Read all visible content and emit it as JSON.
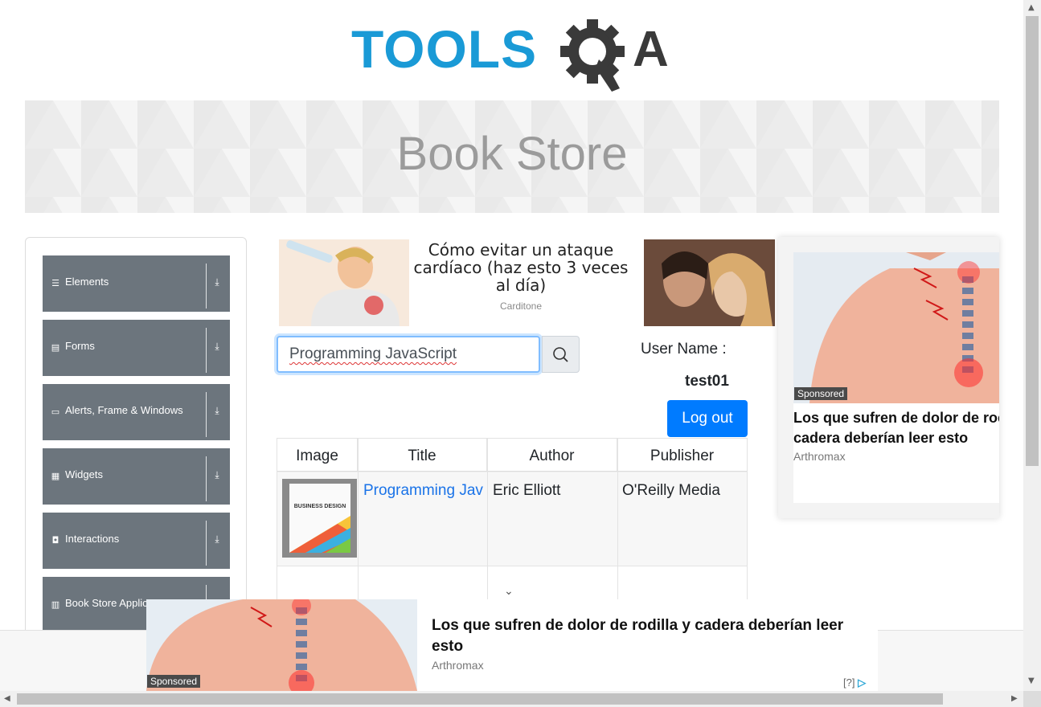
{
  "header": {
    "logo_text": "TOOLS",
    "logo_suffix": "A"
  },
  "banner": {
    "title": "Book Store"
  },
  "sidebar": {
    "items": [
      {
        "label": "Elements",
        "icon": "menu-icon"
      },
      {
        "label": "Forms",
        "icon": "document-icon"
      },
      {
        "label": "Alerts, Frame & Windows",
        "icon": "window-icon"
      },
      {
        "label": "Widgets",
        "icon": "grid-icon"
      },
      {
        "label": "Interactions",
        "icon": "pointer-icon"
      },
      {
        "label": "Book Store Applicat",
        "icon": "books-icon"
      }
    ]
  },
  "ad_top": {
    "title": "Cómo evitar un ataque cardíaco (haz esto 3 veces al día)",
    "source": "Carditone"
  },
  "search": {
    "value": "Programming JavaScript"
  },
  "user": {
    "label": "User Name :",
    "name": "test01",
    "logout_label": "Log out"
  },
  "table": {
    "headers": [
      "Image",
      "Title",
      "Author",
      "Publisher"
    ],
    "rows": [
      {
        "title": "Programming Jav",
        "author": "Eric Elliott",
        "publisher": "O'Reilly Media",
        "cover_text": "BUSINESS DESIGN"
      }
    ]
  },
  "ad_right": {
    "badge": "Sponsored",
    "title": "Los que sufren de dolor de rodilla y cadera deberían leer esto",
    "title_line1": "Los que sufren de dolor de roc",
    "title_line2": "cadera deberían leer esto",
    "source": "Arthromax"
  },
  "ad_bottom": {
    "badge": "Sponsored",
    "title": "Los que sufren de dolor de rodilla y cadera deberían leer esto",
    "source": "Arthromax",
    "adchoice": "[?]"
  },
  "colors": {
    "brand_blue": "#1a9ad6",
    "sidebar_gray": "#6c757d",
    "button_blue": "#007bff",
    "link_blue": "#1a73e8"
  }
}
